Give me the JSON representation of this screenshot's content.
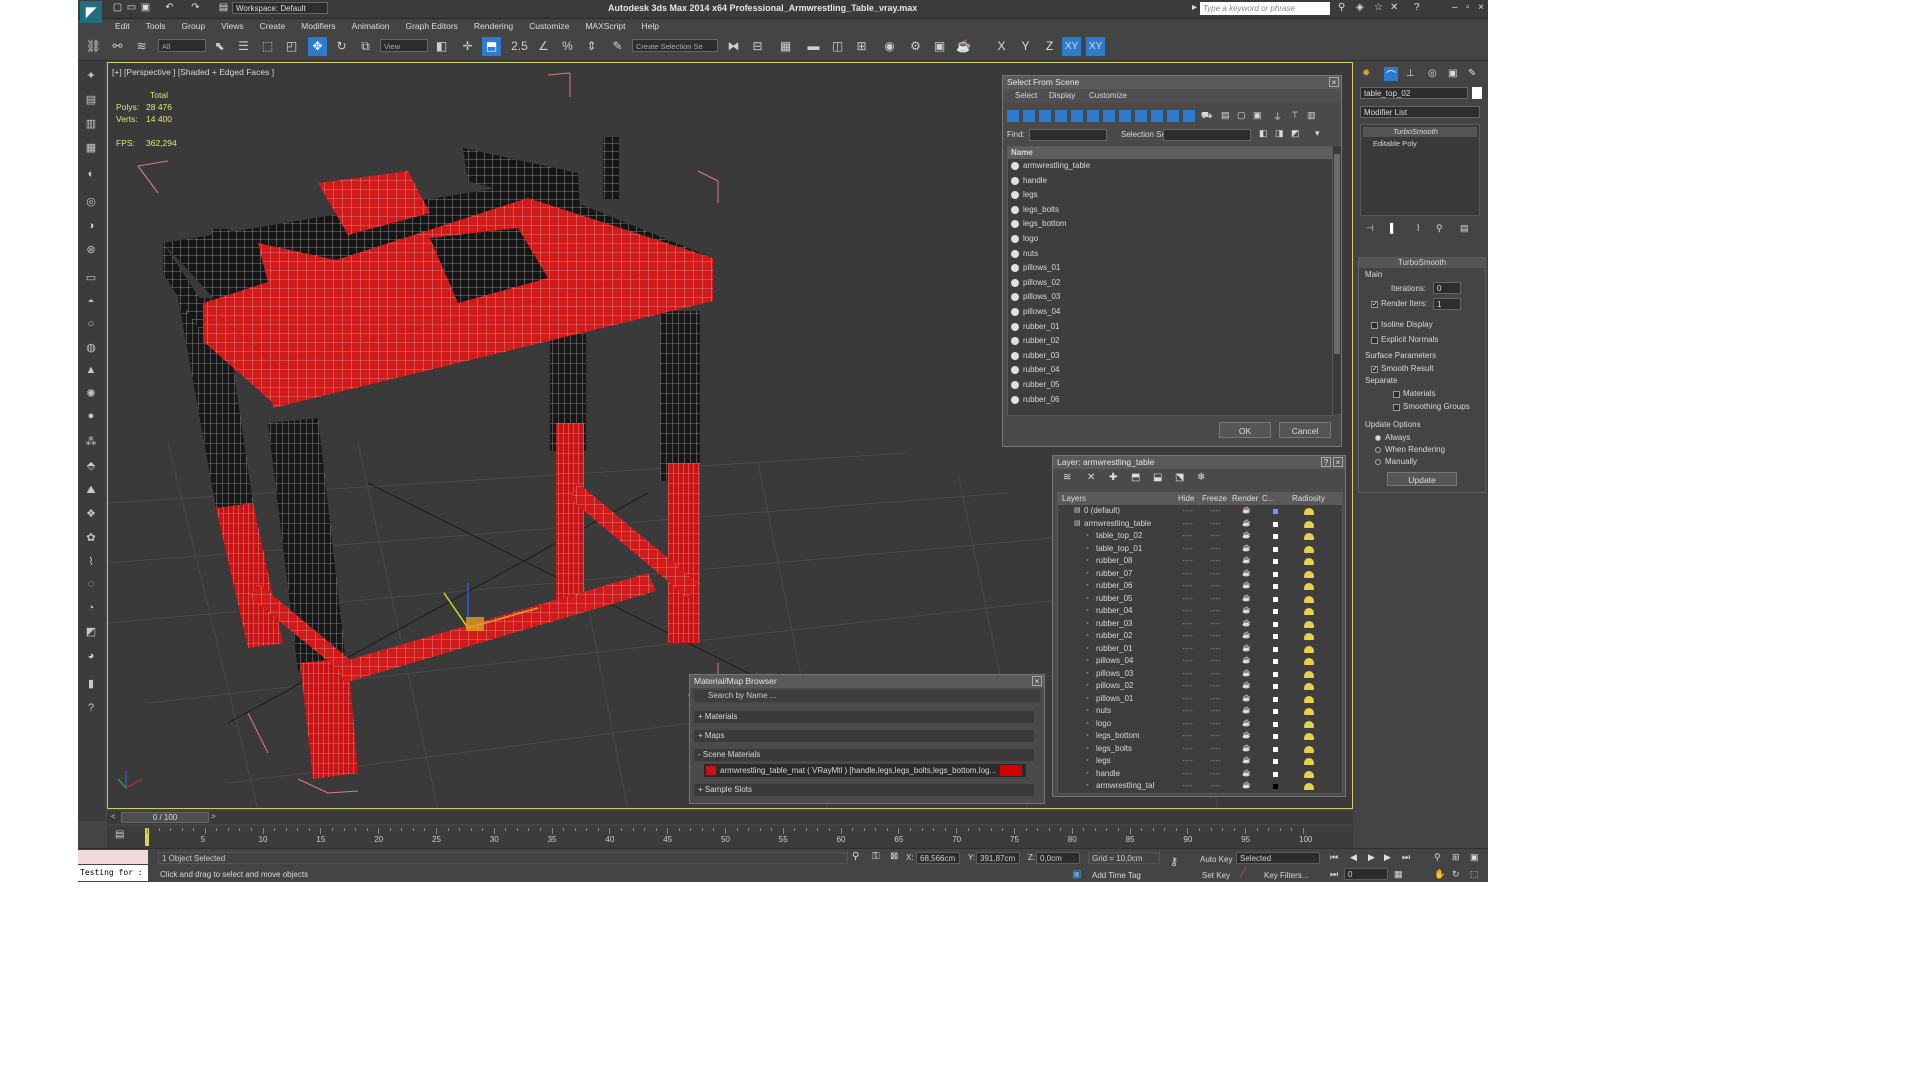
{
  "app": {
    "title": "Autodesk 3ds Max  2014 x64      Professional_Armwrestling_Table_vray.max",
    "workspace": "Workspace: Default",
    "search_placeholder": "Type a keyword or phrase"
  },
  "menu": [
    "Edit",
    "Tools",
    "Group",
    "Views",
    "Create",
    "Modifiers",
    "Animation",
    "Graph Editors",
    "Rendering",
    "Customize",
    "MAXScript",
    "Help"
  ],
  "toolbar": {
    "selection_filter": "All",
    "ref_coord": "View",
    "snap_label": "2.5",
    "named_set_placeholder": "Create Selection Se",
    "axes": [
      "X",
      "Y",
      "Z",
      "XY",
      "XY"
    ]
  },
  "viewport": {
    "label": "[+] [Perspective ] [Shaded + Edged Faces ]",
    "stats": {
      "header": "Total",
      "polys_label": "Polys:",
      "polys": "28 476",
      "verts_label": "Verts:",
      "verts": "14 400",
      "fps_label": "FPS:",
      "fps": "362,294"
    }
  },
  "select_from_scene": {
    "title": "Select From Scene",
    "tabs": [
      "Select",
      "Display",
      "Customize"
    ],
    "find_label": "Find:",
    "selection_set_label": "Selection Set:",
    "column": "Name",
    "items": [
      "armwrestling_table",
      "handle",
      "legs",
      "legs_bolts",
      "legs_bottom",
      "logo",
      "nuts",
      "pillows_01",
      "pillows_02",
      "pillows_03",
      "pillows_04",
      "rubber_01",
      "rubber_02",
      "rubber_03",
      "rubber_04",
      "rubber_05",
      "rubber_06"
    ],
    "ok": "OK",
    "cancel": "Cancel"
  },
  "layer_dialog": {
    "title": "Layer: armwrestling_table",
    "help": "?",
    "columns": [
      "Layers",
      "Hide",
      "Freeze",
      "Render",
      "C...",
      "Radiosity"
    ],
    "rows": [
      "0 (default)",
      "armwrestling_table",
      "table_top_02",
      "table_top_01",
      "rubber_08",
      "rubber_07",
      "rubber_06",
      "rubber_05",
      "rubber_04",
      "rubber_03",
      "rubber_02",
      "rubber_01",
      "pillows_04",
      "pillows_03",
      "pillows_02",
      "pillows_01",
      "nuts",
      "logo",
      "legs_bottom",
      "legs_bolts",
      "legs",
      "handle",
      "armwrestling_tal"
    ]
  },
  "material_browser": {
    "title": "Material/Map Browser",
    "search_placeholder": "Search by Name ...",
    "sections": [
      "+ Materials",
      "+ Maps",
      "- Scene Materials",
      "+ Sample Slots"
    ],
    "scene_material": "armwrestling_table_mat ( VRayMtl ) [handle,legs,legs_bolts,legs_bottom,log..."
  },
  "right_panel": {
    "object_name": "table_top_02",
    "modifier_list": "Modifier List",
    "stack": [
      "TurboSmooth",
      "Editable Poly"
    ],
    "turbosmooth": {
      "title": "TurboSmooth",
      "main": "Main",
      "iterations_label": "Iterations:",
      "iterations": "0",
      "render_iters_label": "Render Iters:",
      "render_iters": "1",
      "isoline": "Isoline Display",
      "explicit": "Explicit Normals",
      "surface": "Surface Parameters",
      "smooth_result": "Smooth Result",
      "separate": "Separate",
      "materials": "Materials",
      "smoothing_groups": "Smoothing Groups",
      "update_options": "Update Options",
      "always": "Always",
      "when_rendering": "When Rendering",
      "manually": "Manually",
      "update": "Update"
    }
  },
  "timeline": {
    "frame": "0 / 100",
    "ticks": [
      "5",
      "10",
      "15",
      "20",
      "25",
      "30",
      "35",
      "40",
      "45",
      "50",
      "55",
      "60",
      "65",
      "70",
      "75",
      "80",
      "85",
      "90",
      "95",
      "100"
    ]
  },
  "status": {
    "maxscript": "Testing for :",
    "selected": "1 Object Selected",
    "prompt": "Click and drag to select and move objects",
    "x_label": "X:",
    "x": "68,566cm",
    "y_label": "Y:",
    "y": "391,87cm",
    "z_label": "Z:",
    "z": "0,0cm",
    "grid": "Grid = 10,0cm",
    "add_time_tag": "Add Time Tag",
    "auto_key": "Auto Key",
    "set_key": "Set Key",
    "key_mode": "Selected",
    "key_filters": "Key Filters...",
    "current_frame": "0"
  }
}
